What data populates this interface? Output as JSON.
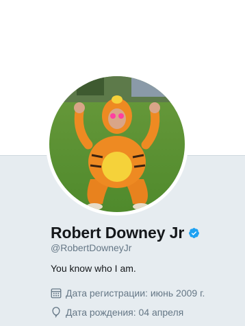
{
  "profile": {
    "name": "Robert Downey Jr",
    "handle": "@RobertDowneyJr",
    "bio": "You know who I am.",
    "verified": true,
    "joined": "Дата регистрации: июнь 2009 г.",
    "birthday": "Дата рождения: 04 апреля"
  },
  "icons": {
    "verified": "verified-badge-icon",
    "joined": "calendar-icon",
    "birthday": "balloon-icon"
  },
  "colors": {
    "verified_blue": "#1da1f2",
    "meta_gray": "#657786",
    "name_dark": "#14171a",
    "background": "#e6ecf0"
  }
}
